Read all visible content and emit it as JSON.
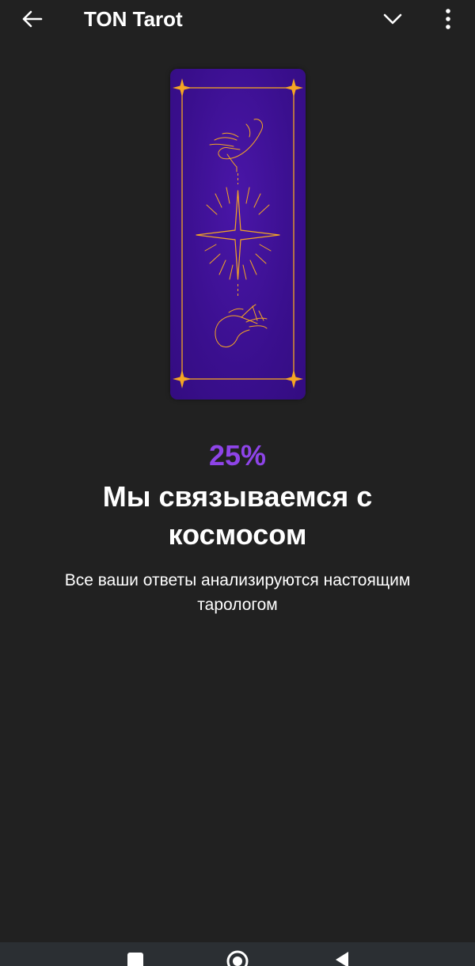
{
  "appbar": {
    "title": "TON Tarot",
    "back_icon": "arrow-left-icon",
    "collapse_icon": "chevron-down-icon",
    "menu_icon": "more-vertical-icon"
  },
  "card": {
    "background": "#3a0f8e",
    "accent": "#f5a623",
    "art_icon": "tarot-card-back-hands-star-icon"
  },
  "progress": {
    "percent_label": "25%",
    "percent_value": 25,
    "color": "#8e44e8"
  },
  "headline": "Мы связываемся с космосом",
  "subtitle": "Все ваши ответы анализируются настоящим тарологом",
  "navbar": {
    "recent_icon": "square-recent-apps-icon",
    "home_icon": "circle-home-icon",
    "back_icon": "triangle-back-icon"
  }
}
